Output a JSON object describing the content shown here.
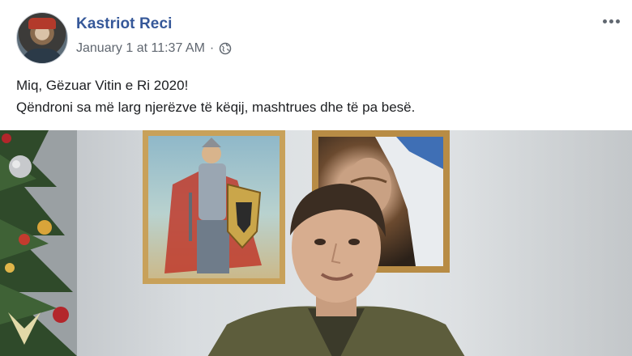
{
  "post": {
    "author": "Kastriot Reci",
    "timestamp": "January 1 at 11:37 AM",
    "separator": "·",
    "privacy_icon": "globe-icon",
    "more_icon": "more-options-icon",
    "text_lines": [
      "Miq, Gëzuar Vitin e Ri 2020!",
      "Qëndroni sa më larg njerëzve të këqij, mashtrues dhe të pa besë."
    ],
    "photo": "post-photo"
  },
  "colors": {
    "author_link": "#365899",
    "meta_text": "#606770",
    "body_text": "#1c1e21"
  }
}
